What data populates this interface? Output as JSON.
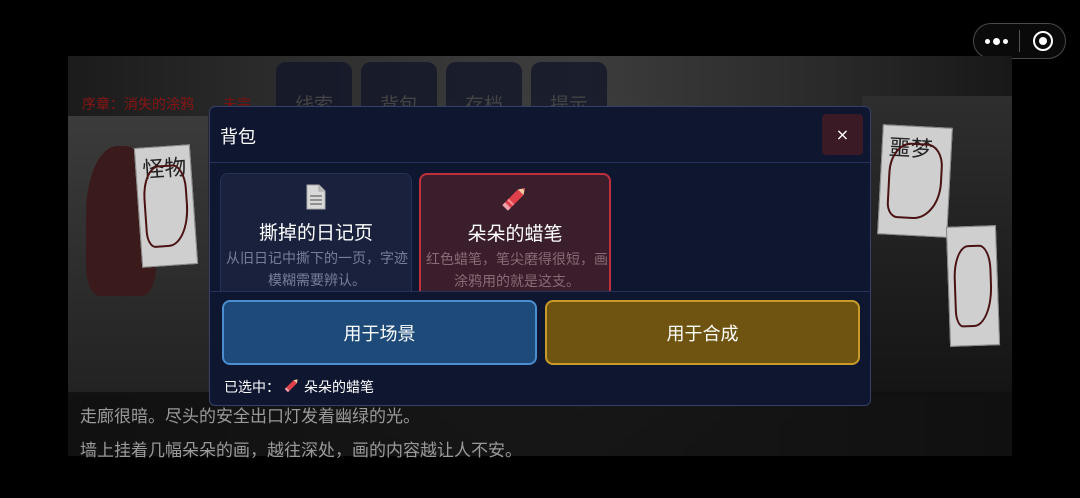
{
  "capsule": {
    "menu_icon": "more-dots-icon",
    "close_icon": "target-circle-icon"
  },
  "game": {
    "chapter_title": "序章：消失的涂鸦",
    "chapter_tag": "未完",
    "top_buttons": [
      "线索",
      "背包",
      "存档",
      "提示"
    ],
    "wall_words": [
      "怪物",
      "噩梦"
    ],
    "story_lines": [
      "走廊很暗。尽头的安全出口灯发着幽绿的光。",
      "墙上挂着几幅朵朵的画，越往深处，画的内容越让人不安。"
    ]
  },
  "modal": {
    "title": "背包",
    "close_label": "×",
    "items": [
      {
        "icon": "document-page-icon",
        "name": "撕掉的日记页",
        "desc": "从旧日记中撕下的一页，字迹模糊需要辨认。",
        "selected": false
      },
      {
        "icon": "crayon-pencil-icon",
        "name": "朵朵的蜡笔",
        "desc": "红色蜡笔，笔尖磨得很短，画涂鸦用的就是这支。",
        "selected": true
      }
    ],
    "use_scene_label": "用于场景",
    "use_craft_label": "用于合成",
    "selected_prefix": "已选中：",
    "selected_item": "朵朵的蜡笔"
  },
  "colors": {
    "accent_red": "#c0303c",
    "scene_blue": "#1d4a78",
    "craft_gold": "#6e5410",
    "modal_bg": "#0f1630"
  }
}
